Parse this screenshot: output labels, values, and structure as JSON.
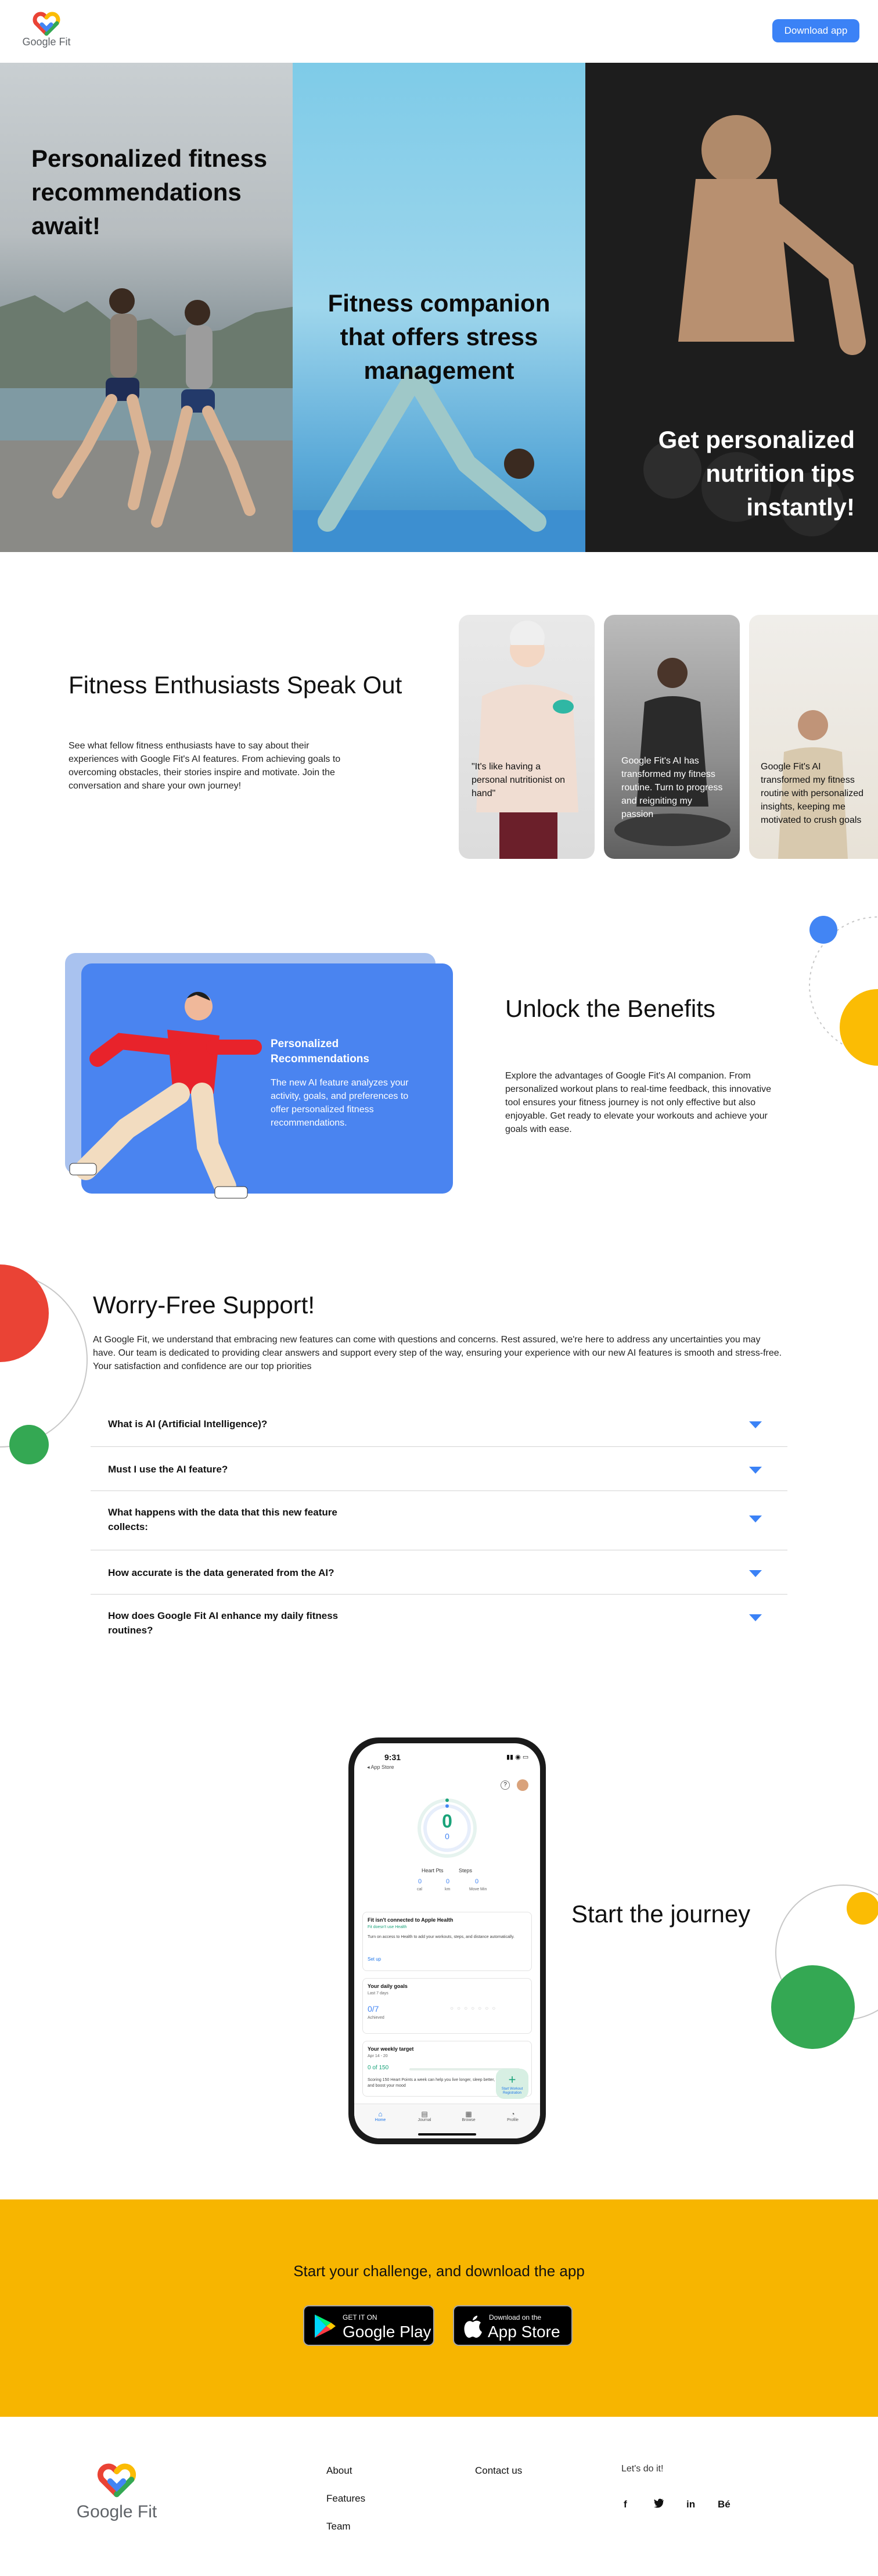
{
  "header": {
    "logo_text": "Google Fit",
    "download_label": "Download app"
  },
  "hero": {
    "panels": [
      {
        "title": "Personalized fitness recommendations await!"
      },
      {
        "title": "Fitness companion that offers stress management"
      },
      {
        "title": "Get personalized nutrition tips instantly!"
      }
    ]
  },
  "testimonials": {
    "title": "Fitness Enthusiasts Speak Out",
    "description": "See what fellow fitness enthusiasts have to say about their experiences with Google Fit's AI features. From achieving goals to overcoming obstacles, their stories inspire and motivate. Join the conversation and share your own journey!",
    "cards": [
      {
        "quote": "\"It's like having a personal nutritionist on hand\""
      },
      {
        "quote": "Google Fit's AI has transformed my fitness routine. Turn to progress and reigniting my passion"
      },
      {
        "quote": "Google Fit's AI transformed my fitness routine with personalized insights, keeping me motivated to crush goals"
      }
    ]
  },
  "benefits": {
    "card_title": "Personalized Recommendations",
    "card_text": "The new AI feature analyzes your activity, goals, and preferences to offer personalized fitness recommendations.",
    "title": "Unlock the Benefits",
    "description": "Explore the advantages of Google Fit's AI companion. From personalized workout plans to real-time feedback, this innovative tool ensures your fitness journey is not only effective but also enjoyable. Get ready to elevate your workouts and achieve your goals with ease."
  },
  "faq": {
    "title": "Worry-Free Support!",
    "description": "At Google Fit, we understand that embracing new features can come with questions and concerns. Rest assured, we're here to address any uncertainties you may have. Our team is dedicated to providing clear answers and support every step of the way, ensuring your experience with our new AI features is smooth and stress-free. Your satisfaction and confidence are our top priorities",
    "items": [
      {
        "q": "What is AI (Artificial Intelligence)?"
      },
      {
        "q": "Must I use the AI feature?"
      },
      {
        "q": "What happens with the data that this new feature collects:"
      },
      {
        "q": "How accurate is the data generated from the AI?"
      },
      {
        "q": "How does Google Fit AI enhance my daily fitness routines?"
      }
    ]
  },
  "journey": {
    "title": "Start the journey",
    "phone": {
      "time": "9:31",
      "back_label": "◂ App Store",
      "ring_value_1": "0",
      "ring_value_2": "0",
      "heart_pts_label": "Heart Pts",
      "steps_label": "Steps",
      "stats": [
        {
          "value": "0",
          "label": "cal"
        },
        {
          "value": "0",
          "label": "km"
        },
        {
          "value": "0",
          "label": "Move Min"
        }
      ],
      "apple_title": "Fit isn't connected to Apple Health",
      "apple_sub": "Fit doesn't use Health",
      "apple_body": "Turn on access to Health to add your workouts, steps, and distance automatically.",
      "apple_action": "Set up",
      "goals_title": "Your daily goals",
      "goals_sub": "Last 7 days",
      "goals_value": "0/7",
      "goals_label": "Achieved",
      "weekly_title": "Your weekly target",
      "weekly_sub": "Apr 14 - 20",
      "weekly_value": "0 of 150",
      "weekly_body": "Scoring 150 Heart Points a week can help you live longer, sleep better, and boost your mood",
      "nav": [
        {
          "label": "Home"
        },
        {
          "label": "Journal"
        },
        {
          "label": "Browse"
        },
        {
          "label": "Profile"
        }
      ],
      "fab_label": "Start Workout Registration"
    }
  },
  "cta": {
    "title": "Start your challenge, and download the app",
    "google_play_small": "GET IT ON",
    "google_play_big": "Google Play",
    "app_store_small": "Download on the",
    "app_store_big": "App Store"
  },
  "footer": {
    "logo_text": "Google Fit",
    "links_col1": [
      "About",
      "Features",
      "Team"
    ],
    "links_col2": [
      "Contact us"
    ],
    "social_label": "Let's do it!",
    "social": [
      {
        "icon": "facebook-icon",
        "glyph": "f"
      },
      {
        "icon": "twitter-icon",
        "glyph": "🐦"
      },
      {
        "icon": "linkedin-icon",
        "glyph": "in"
      },
      {
        "icon": "behance-icon",
        "glyph": "Bé"
      }
    ]
  },
  "colors": {
    "accent_blue": "#3b82f6",
    "benefit_blue": "#4a84f0",
    "cta_yellow": "#f7b500",
    "deco_red": "#ea4335",
    "deco_green": "#34a853",
    "deco_yellow": "#fbbc04"
  }
}
